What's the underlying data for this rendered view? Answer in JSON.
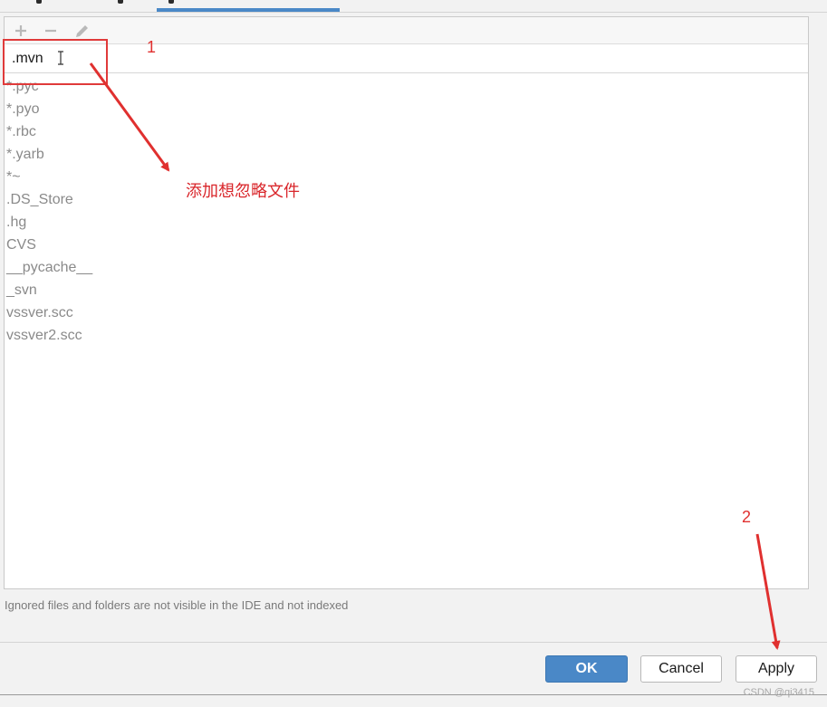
{
  "toolbar": {
    "add_icon": "plus-icon",
    "remove_icon": "minus-icon",
    "edit_icon": "pencil-icon"
  },
  "editor": {
    "value": ".mvn"
  },
  "ignored_list": [
    "*.pyc",
    "*.pyo",
    "*.rbc",
    "*.yarb",
    "*~",
    ".DS_Store",
    ".hg",
    "CVS",
    "__pycache__",
    "_svn",
    "vssver.scc",
    "vssver2.scc"
  ],
  "hint": "Ignored files and folders are not visible in the IDE and not indexed",
  "buttons": {
    "ok": "OK",
    "cancel": "Cancel",
    "apply": "Apply"
  },
  "annotations": {
    "step1": "1",
    "step1_text": "添加想忽略文件",
    "step2": "2"
  },
  "watermark": "CSDN @qi3415",
  "colors": {
    "accent": "#4a88c7",
    "annotation": "#e0302f"
  }
}
